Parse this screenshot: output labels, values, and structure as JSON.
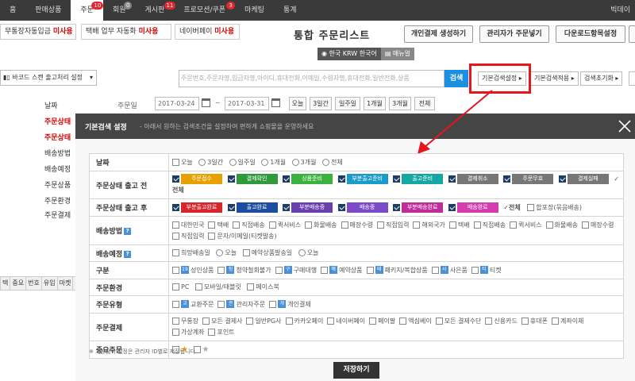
{
  "nav": {
    "items": [
      {
        "label": "홈",
        "badge": ""
      },
      {
        "label": "판매상품",
        "badge": ""
      },
      {
        "label": "주문",
        "badge": "10"
      },
      {
        "label": "회원",
        "badge": "0"
      },
      {
        "label": "게시판",
        "badge": "11"
      },
      {
        "label": "프로모션/쿠폰",
        "badge": "3"
      },
      {
        "label": "마케팅",
        "badge": ""
      },
      {
        "label": "통계",
        "badge": ""
      }
    ],
    "user": "빅데이"
  },
  "notices": [
    {
      "label": "무통장자동입금",
      "status": "미사용"
    },
    {
      "label": "택배 업무 자동화",
      "status": "미사용"
    },
    {
      "label": "네이버페이",
      "status": "미사용"
    }
  ],
  "page_title": "통합 주문리스트",
  "top_buttons": [
    "개인결제 생성하기",
    "관리자가 주문넣기",
    "다운로드항목설정"
  ],
  "currency": {
    "left": "한국 KRW 한국어",
    "right": "매뉴얼"
  },
  "barcode_select": "바코드 스캔 출고처리 설정",
  "left_labels": [
    {
      "text": "날짜",
      "red": false
    },
    {
      "text": "주문상태",
      "red": true
    },
    {
      "text": "주문상태",
      "red": true
    },
    {
      "text": "배송방법",
      "red": false
    },
    {
      "text": "배송예정",
      "red": false
    },
    {
      "text": "주문상품",
      "red": false
    },
    {
      "text": "주문환경",
      "red": false
    },
    {
      "text": "주문결제",
      "red": false
    }
  ],
  "left_table_headers": [
    "택",
    "중요",
    "번호",
    "유입",
    "마켓"
  ],
  "search": {
    "placeholder": "주문번호,주문자명,입금자명,아이디,휴대전화,이메일,수령자명,휴대전화,일반전화,상품",
    "button": "검색",
    "buttons": [
      "기본검색설정",
      "기본검색적용",
      "검색초기화"
    ]
  },
  "date": {
    "label": "주문일",
    "from": "2017-03-24",
    "to": "2017-03-31",
    "separator": "~",
    "quick": [
      "오늘",
      "3일간",
      "일주일",
      "1개월",
      "3개월",
      "전체"
    ]
  },
  "modal": {
    "title": "기본검색 설정",
    "subtitle": "- 아래서 원하는 검색조건을 설정하여 편하게 쇼핑몰을 운영하세요",
    "rows": {
      "date": {
        "label": "날짜",
        "options": [
          "오늘",
          "3일간",
          "일주일",
          "1개월",
          "3개월",
          "전체"
        ]
      },
      "status_before": {
        "label": "주문상태 출고 전",
        "tags": [
          {
            "text": "주문접수",
            "color": "#e8a000"
          },
          {
            "text": "결제확인",
            "color": "#2f9a3c"
          },
          {
            "text": "상품준비",
            "color": "#39b33d"
          },
          {
            "text": "부분출고준비",
            "color": "#1a9cc9"
          },
          {
            "text": "출고준비",
            "color": "#15a8a2"
          },
          {
            "text": "결제취소",
            "color": "#777777"
          },
          {
            "text": "주문무효",
            "color": "#777777"
          },
          {
            "text": "결제실패",
            "color": "#777777"
          }
        ],
        "all": "전체"
      },
      "status_after": {
        "label": "주문상태 출고 후",
        "tags": [
          {
            "text": "부분출고완료",
            "color": "#d8262d"
          },
          {
            "text": "출고완료",
            "color": "#1c4da0"
          },
          {
            "text": "부분배송중",
            "color": "#6a3fb0"
          },
          {
            "text": "배송중",
            "color": "#7d4ac9"
          },
          {
            "text": "부분배송완료",
            "color": "#c02d9a"
          },
          {
            "text": "배송완료",
            "color": "#d43cb0"
          }
        ],
        "all": "전체",
        "extra": "합포장(묶음배송)"
      },
      "shipping": {
        "label": "배송방법",
        "help": "?",
        "options": [
          "대한민국",
          "택배",
          "직접배송",
          "퀵서비스",
          "화물배송",
          "매장수령",
          "직접입력",
          "해외국가",
          "택배",
          "직접배송",
          "퀵서비스",
          "화물배송",
          "매장수령",
          "직접입력",
          "문자/이메일(티켓발송)"
        ]
      },
      "expected": {
        "label": "배송예정",
        "help": "?",
        "options": [
          "희망배송일",
          "오늘",
          "예약상품발송일",
          "오늘"
        ]
      },
      "category": {
        "label": "구분",
        "options": [
          {
            "icon": "19",
            "text": "성인상품"
          },
          {
            "icon": "청",
            "text": "청약철회불가"
          },
          {
            "icon": "구",
            "text": "구매대행"
          },
          {
            "icon": "예",
            "text": "예약상품"
          },
          {
            "icon": "패",
            "text": "패키지/복합상품"
          },
          {
            "icon": "사",
            "text": "사은품"
          },
          {
            "icon": "티",
            "text": "티켓"
          }
        ]
      },
      "environment": {
        "label": "주문환경",
        "options": [
          "PC",
          "모바일/태블릿",
          "페이스북"
        ]
      },
      "type": {
        "label": "주문유형",
        "options": [
          {
            "icon": "교",
            "text": "교환주문"
          },
          {
            "icon": "관",
            "text": "관리자주문"
          },
          {
            "icon": "개",
            "text": "개인결제"
          }
        ]
      },
      "payment": {
        "label": "주문결제",
        "options": [
          "무통장",
          "모든 결제사",
          "일반PG사",
          "카카오페이",
          "네이버페이",
          "페이팔",
          "엑심베이",
          "모든 결제수단",
          "신용카드",
          "휴대폰",
          "계좌이체",
          "가상계좌",
          "포인트"
        ]
      },
      "important": {
        "label": "중요주문"
      }
    },
    "footnote": "※ 기본검색 설정은 관리자 ID별로 저장됩니다.",
    "save": "저장하기"
  }
}
